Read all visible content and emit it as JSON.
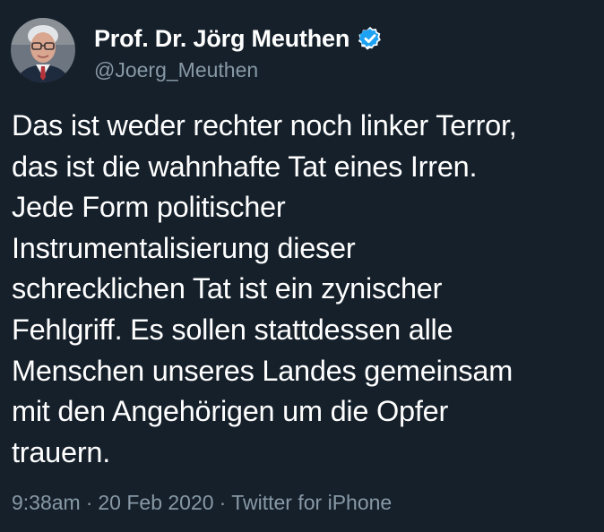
{
  "author": {
    "display_name": "Prof. Dr. Jörg Meuthen",
    "handle": "@Joerg_Meuthen",
    "verified_icon": "verified-badge-icon",
    "avatar_icon": "profile-photo"
  },
  "tweet": {
    "lines": [
      "Das ist weder rechter noch linker Terror,",
      "das ist die wahnhafte Tat eines Irren.",
      "Jede Form politischer",
      "Instrumentalisierung dieser",
      "schrecklichen Tat ist ein zynischer",
      "Fehlgriff. Es sollen stattdessen alle",
      "Menschen unseres Landes gemeinsam",
      "mit den Angehörigen um die Opfer",
      "trauern."
    ]
  },
  "meta": {
    "time": "9:38am",
    "separator": "·",
    "date": "20 Feb 2020",
    "source": "Twitter for iPhone"
  },
  "colors": {
    "background": "#15202b",
    "text": "#ffffff",
    "secondary": "#8899a6",
    "verified": "#1da1f2"
  }
}
